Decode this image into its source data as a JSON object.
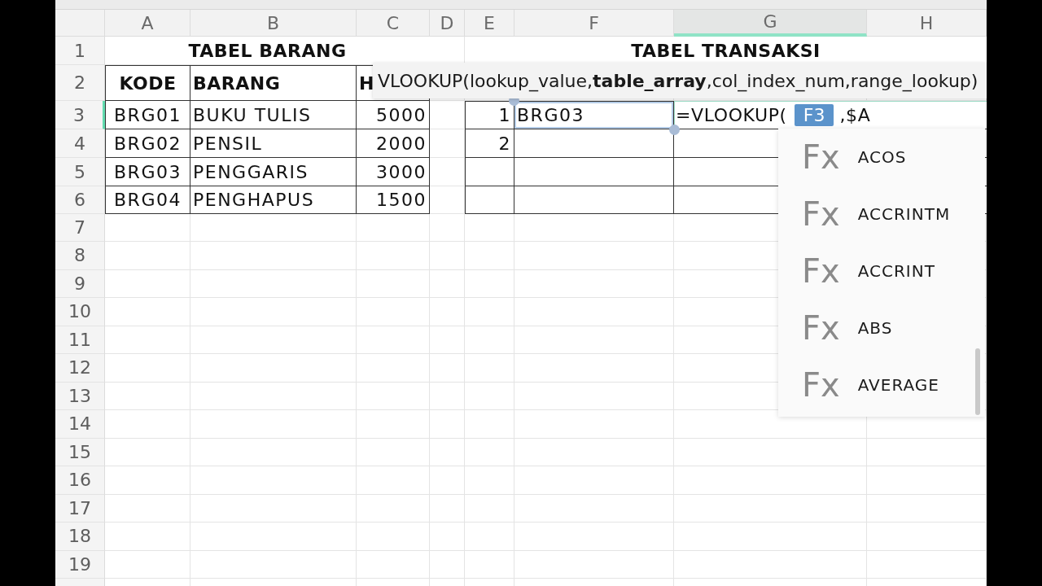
{
  "column_headers": [
    {
      "label": "A",
      "selected": false
    },
    {
      "label": "B",
      "selected": false
    },
    {
      "label": "C",
      "selected": false
    },
    {
      "label": "D",
      "selected": false
    },
    {
      "label": "E",
      "selected": false
    },
    {
      "label": "F",
      "selected": false
    },
    {
      "label": "G",
      "selected": true
    },
    {
      "label": "H",
      "selected": false
    }
  ],
  "row_headers": [
    {
      "label": "1",
      "selected": false
    },
    {
      "label": "2",
      "selected": false
    },
    {
      "label": "3",
      "selected": true
    },
    {
      "label": "4",
      "selected": false
    },
    {
      "label": "5",
      "selected": false
    },
    {
      "label": "6",
      "selected": false
    },
    {
      "label": "7",
      "selected": false
    },
    {
      "label": "8",
      "selected": false
    },
    {
      "label": "9",
      "selected": false
    },
    {
      "label": "10",
      "selected": false
    },
    {
      "label": "11",
      "selected": false
    },
    {
      "label": "12",
      "selected": false
    },
    {
      "label": "13",
      "selected": false
    },
    {
      "label": "14",
      "selected": false
    },
    {
      "label": "15",
      "selected": false
    },
    {
      "label": "16",
      "selected": false
    },
    {
      "label": "17",
      "selected": false
    },
    {
      "label": "18",
      "selected": false
    },
    {
      "label": "19",
      "selected": false
    }
  ],
  "tabel_barang": {
    "title": "TABEL BARANG",
    "header": [
      "KODE",
      "BARANG",
      "H"
    ],
    "rows": [
      [
        "BRG01",
        "BUKU TULIS",
        "5000"
      ],
      [
        "BRG02",
        "PENSIL",
        "2000"
      ],
      [
        "BRG03",
        "PENGGARIS",
        "3000"
      ],
      [
        "BRG04",
        "PENGHAPUS",
        "1500"
      ]
    ]
  },
  "tabel_transaksi": {
    "title": "TABEL TRANSAKSI",
    "rows": [
      {
        "cells": [
          "1",
          "BRG03"
        ],
        "reference_highlight": true,
        "editor": {
          "parts": [
            {
              "kind": "text",
              "text": "=VLOOKUP("
            },
            {
              "kind": "reference",
              "text": "F3"
            },
            {
              "kind": "text",
              "text": ",$A"
            }
          ]
        }
      },
      {
        "cells": [
          "2"
        ],
        "reference_highlight": false
      }
    ]
  },
  "formula_hint": "VLOOKUP(lookup_value,**table_array**,col_index_num,range_lookup)",
  "function_suggestions": [
    {
      "icon_text": "Fx",
      "name": "ACOS"
    },
    {
      "icon_text": "Fx",
      "name": "ACCRINTM"
    },
    {
      "icon_text": "Fx",
      "name": "ACCRINT"
    },
    {
      "icon_text": "Fx",
      "name": "ABS"
    },
    {
      "icon_text": "Fx",
      "name": "AVERAGE"
    }
  ]
}
